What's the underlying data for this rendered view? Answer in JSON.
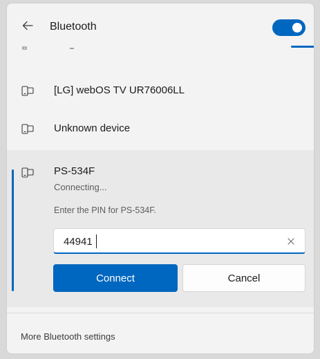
{
  "header": {
    "title": "Bluetooth",
    "back_icon": "arrow-left-icon",
    "toggle_state": "on",
    "accent_color": "#0067c0"
  },
  "devices": [
    {
      "name": "[LG] webOS TV UR76006LL",
      "icon": "device-icon"
    },
    {
      "name": "Unknown device",
      "icon": "device-icon"
    }
  ],
  "selected_device": {
    "name": "PS-534F",
    "status": "Connecting...",
    "pin_prompt": "Enter the PIN for PS-534F.",
    "pin_value": "44941",
    "clear_icon": "close-icon",
    "connect_label": "Connect",
    "cancel_label": "Cancel"
  },
  "footer": {
    "link_label": "More Bluetooth settings"
  }
}
